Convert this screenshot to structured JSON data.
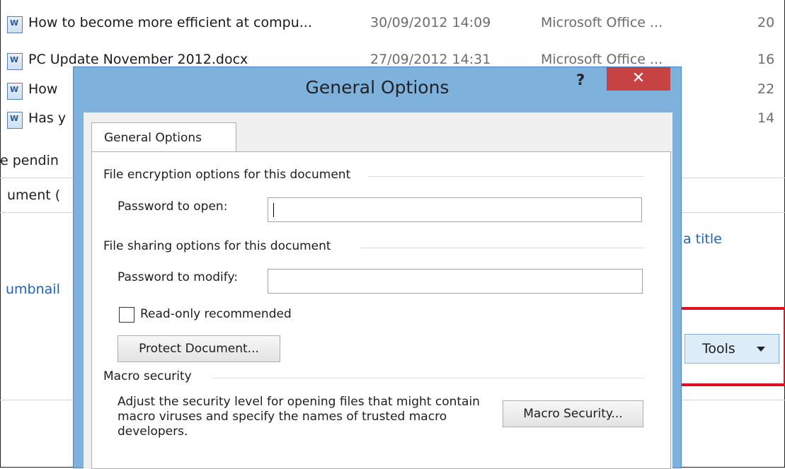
{
  "files": [
    {
      "name": "How to become more efficient at compu...",
      "date": "30/09/2012 14:09",
      "type": "Microsoft Office ...",
      "size": "20"
    },
    {
      "name": "PC Update November 2012.docx",
      "date": "27/09/2012 14:31",
      "type": "Microsoft Office ...",
      "size": "16"
    },
    {
      "name": "How",
      "date": "",
      "type": "",
      "size": "22"
    },
    {
      "name": "Has y",
      "date": "",
      "type": "",
      "size": "14"
    }
  ],
  "background": {
    "pending_text": "e pendin",
    "document_text": "ument (",
    "title_link": "a title",
    "thumbnail_text": "umbnail"
  },
  "dialog": {
    "title": "General Options",
    "help_label": "?",
    "close_label": "✕",
    "tab_label": "General Options",
    "encryption_section": "File encryption options for this document",
    "password_open_label": "Password to open:",
    "password_open_value": "",
    "sharing_section": "File sharing options for this document",
    "password_modify_label": "Password to modify:",
    "password_modify_value": "",
    "readonly_label": "Read-only recommended",
    "protect_button": "Protect Document...",
    "macro_section": "Macro security",
    "macro_description": "Adjust the security level for opening files that might contain macro viruses and specify the names of trusted macro developers.",
    "macro_button": "Macro Security..."
  },
  "tools": {
    "label": "Tools",
    "highlight_color": "#e0111e"
  },
  "icons": {
    "file_icon": "word-document-icon",
    "dropdown": "chevron-down-icon"
  }
}
